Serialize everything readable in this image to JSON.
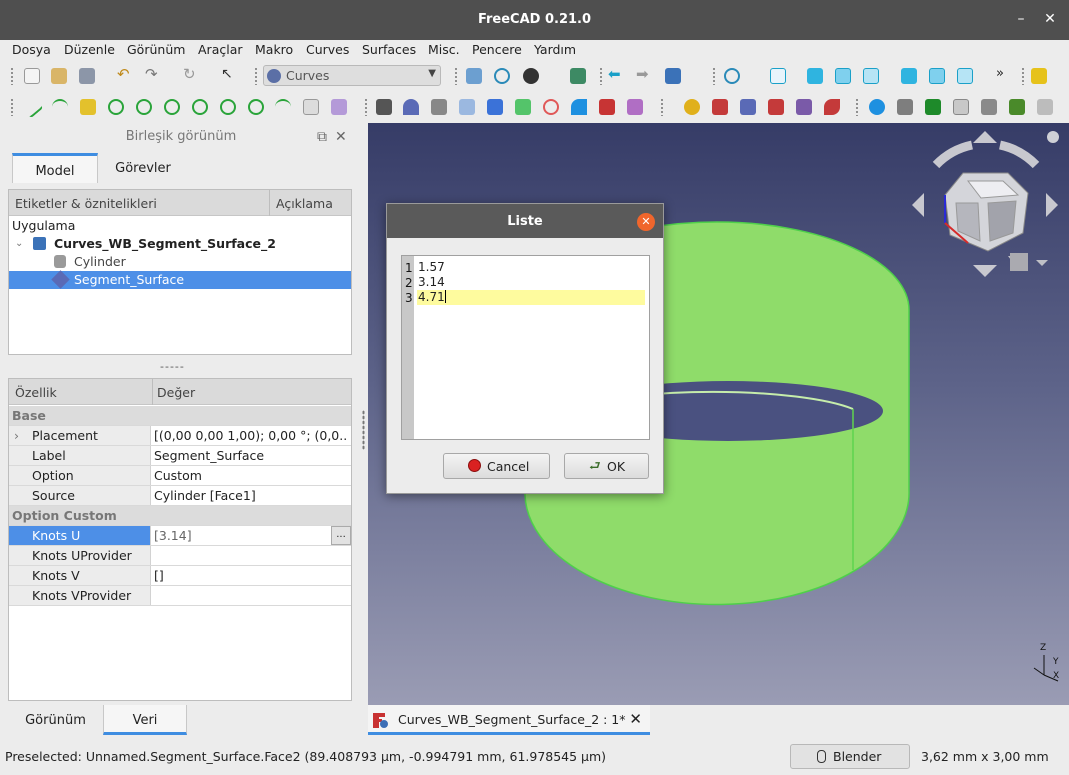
{
  "window": {
    "title": "FreeCAD 0.21.0",
    "minimize": "–",
    "close": "✕"
  },
  "menu": [
    "Dosya",
    "Düzenle",
    "Görünüm",
    "Araçlar",
    "Makro",
    "Curves",
    "Surfaces",
    "Misc.",
    "Pencere",
    "Yardım"
  ],
  "toolbar": {
    "workbench": "Curves",
    "overflow": "»"
  },
  "combo_view": {
    "title": "Birleşik görünüm",
    "tabs": [
      "Model",
      "Görevler"
    ],
    "active_tab": "Model",
    "tree_headers": [
      "Etiketler & öznitelikleri",
      "Açıklama"
    ],
    "tree_items": {
      "app": "Uygulama",
      "document": "Curves_WB_Segment_Surface_2",
      "cylinder": "Cylinder",
      "segment": "Segment_Surface"
    },
    "splitter": "-----"
  },
  "properties": {
    "headers": [
      "Özellik",
      "Değer"
    ],
    "groups": {
      "base": "Base",
      "option_custom": "Option Custom"
    },
    "rows": {
      "placement": {
        "name": "Placement",
        "value": "[(0,00 0,00 1,00); 0,00 °; (0,0..."
      },
      "label": {
        "name": "Label",
        "value": "Segment_Surface"
      },
      "option": {
        "name": "Option",
        "value": "Custom"
      },
      "source": {
        "name": "Source",
        "value": "Cylinder [Face1]"
      },
      "knots_u": {
        "name": "Knots U",
        "value": "[3.14]"
      },
      "knots_uprovider": {
        "name": "Knots UProvider",
        "value": ""
      },
      "knots_v": {
        "name": "Knots V",
        "value": "[]"
      },
      "knots_vprovider": {
        "name": "Knots VProvider",
        "value": ""
      }
    },
    "ellipsis": "..."
  },
  "bottom_tabs": [
    "Görünüm",
    "Veri"
  ],
  "active_bottom_tab": "Veri",
  "document_tab": {
    "label": "Curves_WB_Segment_Surface_2 : 1*",
    "close": "✕"
  },
  "status": {
    "message": "Preselected: Unnamed.Segment_Surface.Face2 (89.408793 µm, -0.994791 mm, 61.978545 µm)",
    "navigation": "Blender",
    "dimensions": "3,62 mm x 3,00 mm"
  },
  "dialog": {
    "title": "Liste",
    "close": "✕",
    "line_numbers": [
      "1",
      "2",
      "3"
    ],
    "lines": [
      "1.57",
      "3.14",
      "4.71"
    ],
    "cancel": "Cancel",
    "ok": "OK"
  },
  "axis_labels": {
    "z": "Z",
    "y": "Y",
    "x": "X"
  },
  "colors": {
    "accent": "#3e8de1",
    "selection": "#4d8fe7",
    "surface": "#8fdc6a",
    "current_line": "#fefb9e",
    "dialog_close": "#f0662c"
  }
}
